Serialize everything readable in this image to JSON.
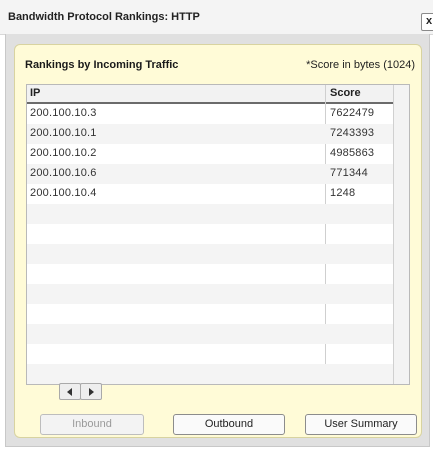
{
  "window": {
    "title": "Bandwidth Protocol Rankings: HTTP",
    "close_label": "x"
  },
  "panel": {
    "title": "Rankings by Incoming Traffic",
    "score_note": "*Score in bytes (1024)"
  },
  "grid": {
    "columns": [
      "IP",
      "Score"
    ],
    "rows": [
      {
        "ip": "200.100.10.3",
        "score": "7622479"
      },
      {
        "ip": "200.100.10.1",
        "score": "7243393"
      },
      {
        "ip": "200.100.10.2",
        "score": "4985863"
      },
      {
        "ip": "200.100.10.6",
        "score": "771344"
      },
      {
        "ip": "200.100.10.4",
        "score": "1248"
      }
    ]
  },
  "buttons": {
    "inbound": "Inbound",
    "outbound": "Outbound",
    "user_summary": "User Summary"
  }
}
